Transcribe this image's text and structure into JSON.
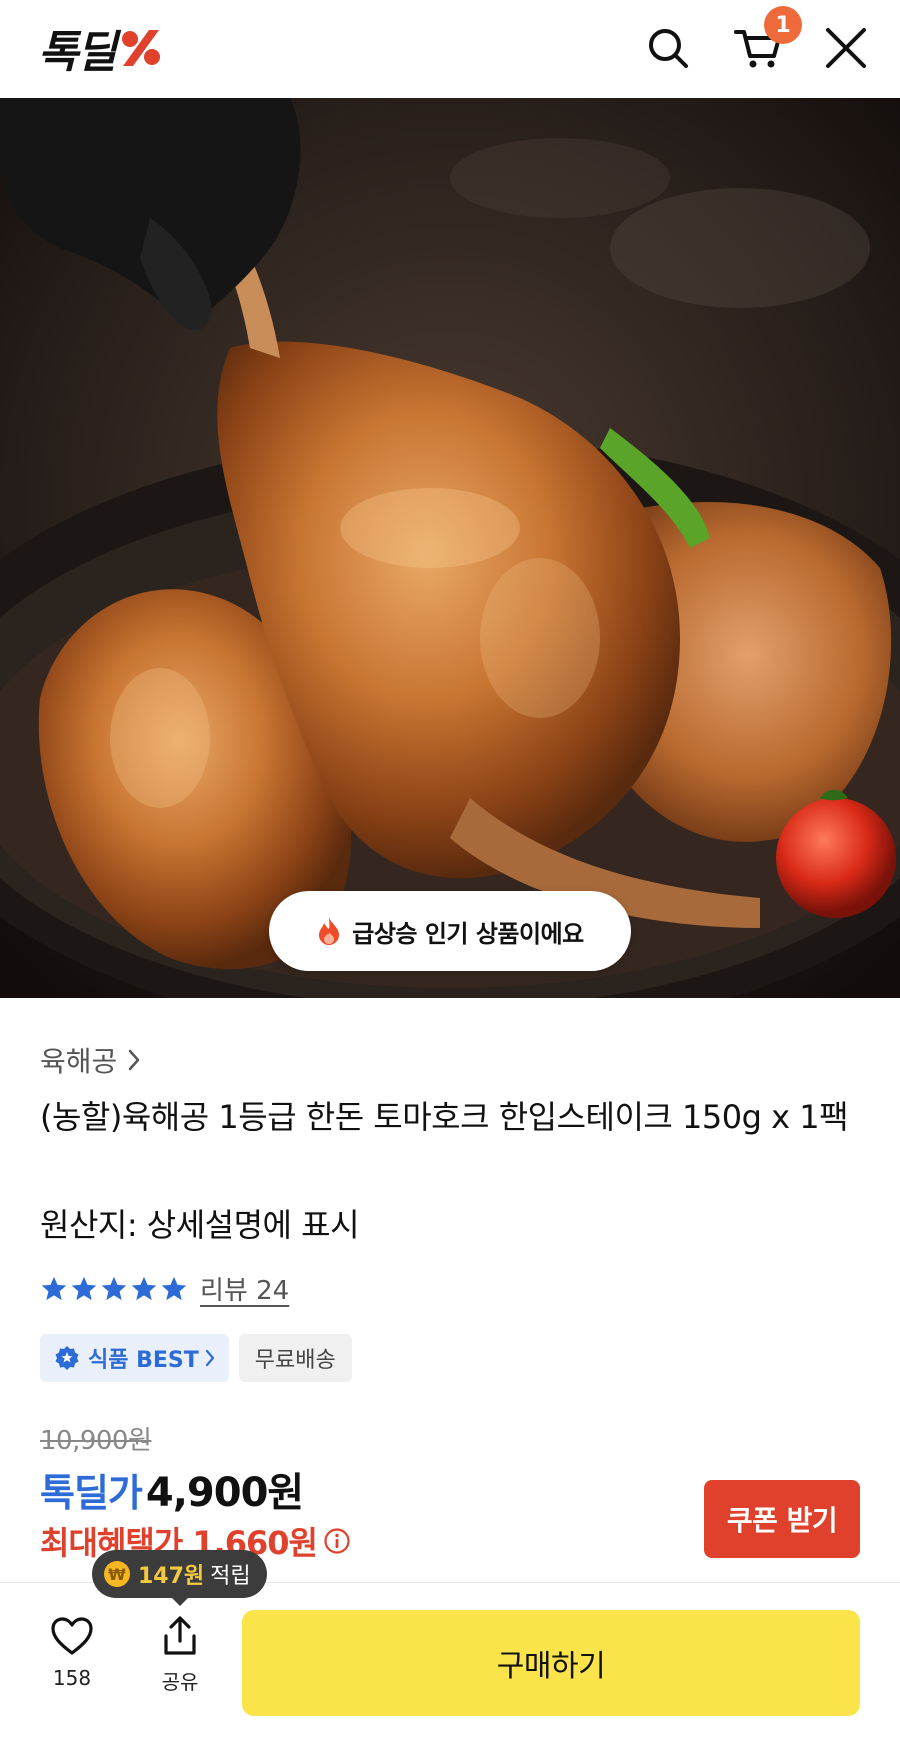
{
  "header": {
    "logo_text": "톡딜",
    "logo_mark": "%",
    "cart_count": "1",
    "icons": [
      "search-icon",
      "cart-icon",
      "close-icon"
    ]
  },
  "hero": {
    "badge_text": "급상승 인기 상품이에요",
    "badge_icon": "fire-icon"
  },
  "product": {
    "brand": "육해공",
    "title": "(농할)육해공 1등급 한돈 토마호크 한입스테이크 150g x 1팩",
    "origin": "원산지: 상세설명에 표시",
    "rating_stars": 5,
    "review_label": "리뷰 24",
    "badges": {
      "best": "식품 BEST",
      "free_shipping": "무료배송"
    },
    "original_price": "10,900원",
    "deal_label": "톡딜가",
    "deal_price": "4,900원",
    "max_benefit": "최대혜택가 1,660원",
    "coupon_button": "쿠폰 받기"
  },
  "bottom_bar": {
    "points_amount": "147원",
    "points_label": "적립",
    "like_count": "158",
    "share_label": "공유",
    "buy_button": "구매하기"
  },
  "colors": {
    "brand_blue": "#2d6bd6",
    "price_red": "#e0412c",
    "buy_yellow": "#fbe34a",
    "badge_orange": "#ef6a3a"
  }
}
